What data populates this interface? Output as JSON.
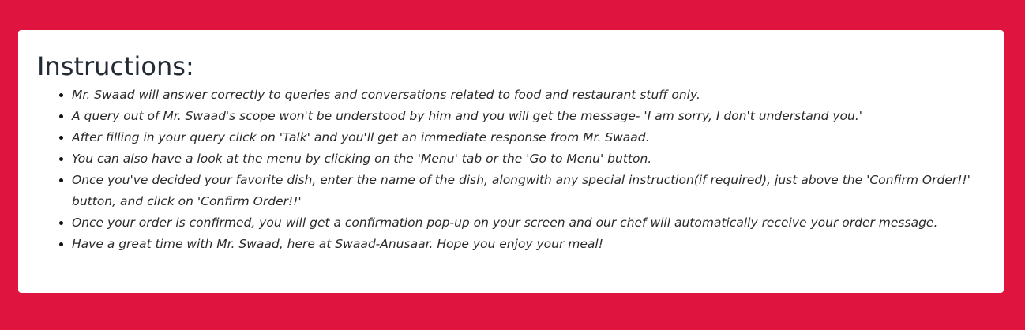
{
  "colors": {
    "background": "#e0153f",
    "card": "#ffffff",
    "heading": "#222a33",
    "text": "#2a2a2a"
  },
  "instructions": {
    "title": "Instructions:",
    "items": [
      "Mr. Swaad will answer correctly to queries and conversations related to food and restaurant stuff only.",
      "A query out of Mr. Swaad's scope won't be understood by him and you will get the message- 'I am sorry, I don't understand you.'",
      "After filling in your query click on 'Talk' and you'll get an immediate response from Mr. Swaad.",
      "You can also have a look at the menu by clicking on the 'Menu' tab or the 'Go to Menu' button.",
      "Once you've decided your favorite dish, enter the name of the dish, alongwith any special instruction(if required), just above the 'Confirm Order!!' button, and click on 'Confirm Order!!'",
      "Once your order is confirmed, you will get a confirmation pop-up on your screen and our chef will automatically receive your order message.",
      "Have a great time with Mr. Swaad, here at Swaad-Anusaar. Hope you enjoy your meal!"
    ]
  }
}
